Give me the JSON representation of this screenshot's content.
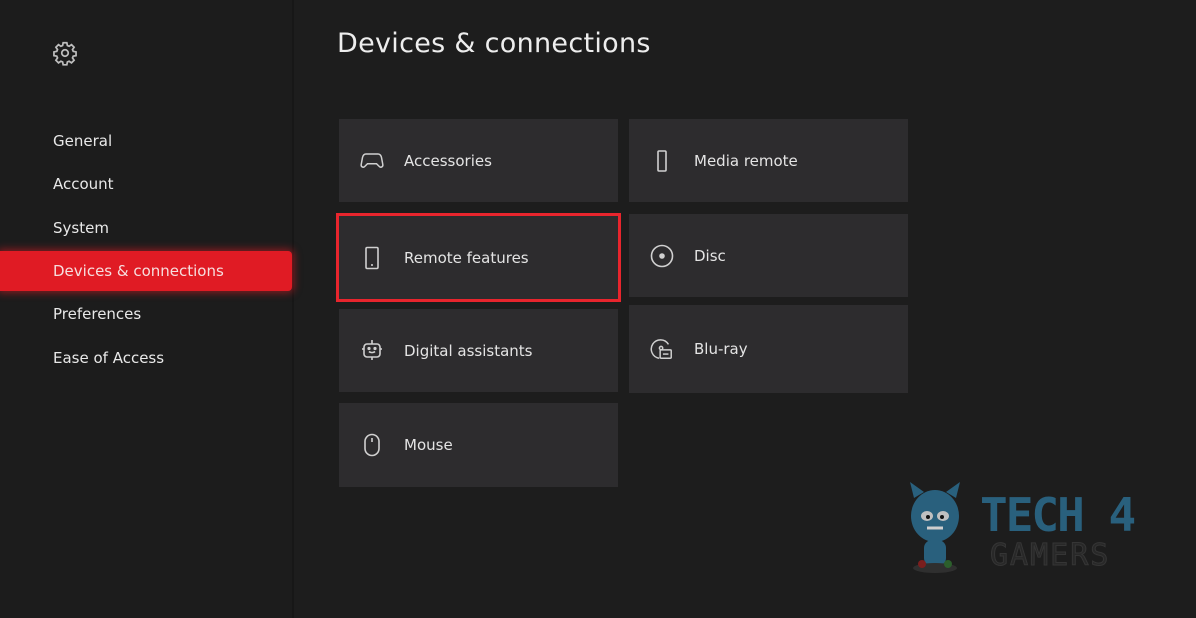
{
  "page": {
    "title": "Devices & connections"
  },
  "sidebar": {
    "icon": "gear-icon",
    "items": [
      {
        "label": "General",
        "active": false
      },
      {
        "label": "Account",
        "active": false
      },
      {
        "label": "System",
        "active": false
      },
      {
        "label": "Devices & connections",
        "active": true
      },
      {
        "label": "Preferences",
        "active": false
      },
      {
        "label": "Ease of Access",
        "active": false
      }
    ]
  },
  "tiles": [
    {
      "label": "Accessories",
      "icon": "gamepad-icon",
      "focused": false
    },
    {
      "label": "Media remote",
      "icon": "remote-icon",
      "focused": false
    },
    {
      "label": "Remote features",
      "icon": "phone-icon",
      "focused": true
    },
    {
      "label": "Disc",
      "icon": "disc-icon",
      "focused": false
    },
    {
      "label": "Digital assistants",
      "icon": "robot-icon",
      "focused": false
    },
    {
      "label": "Blu-ray",
      "icon": "bluray-icon",
      "focused": false
    },
    {
      "label": "Mouse",
      "icon": "mouse-icon",
      "focused": false
    }
  ],
  "watermark": {
    "line1": "TECH 4",
    "line2": "GAMERS"
  },
  "colors": {
    "accent": "#e01b24",
    "focus_outline": "#e8252d",
    "tile_bg": "#2d2c2e",
    "background": "#1d1d1d"
  }
}
